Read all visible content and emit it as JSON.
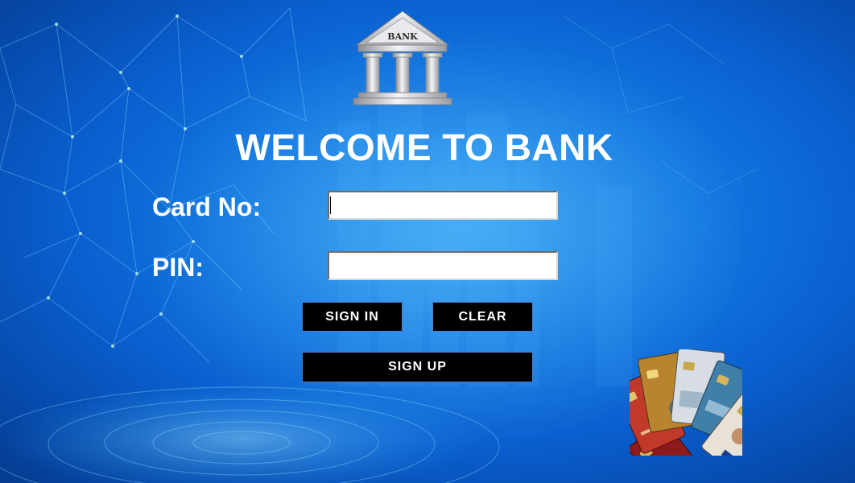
{
  "logo": {
    "text": "BANK"
  },
  "title": "WELCOME TO BANK",
  "form": {
    "card_label": "Card No:",
    "card_value": "",
    "pin_label": "PIN:",
    "pin_value": ""
  },
  "buttons": {
    "sign_in": "SIGN IN",
    "clear": "CLEAR",
    "sign_up": "SIGN UP"
  }
}
